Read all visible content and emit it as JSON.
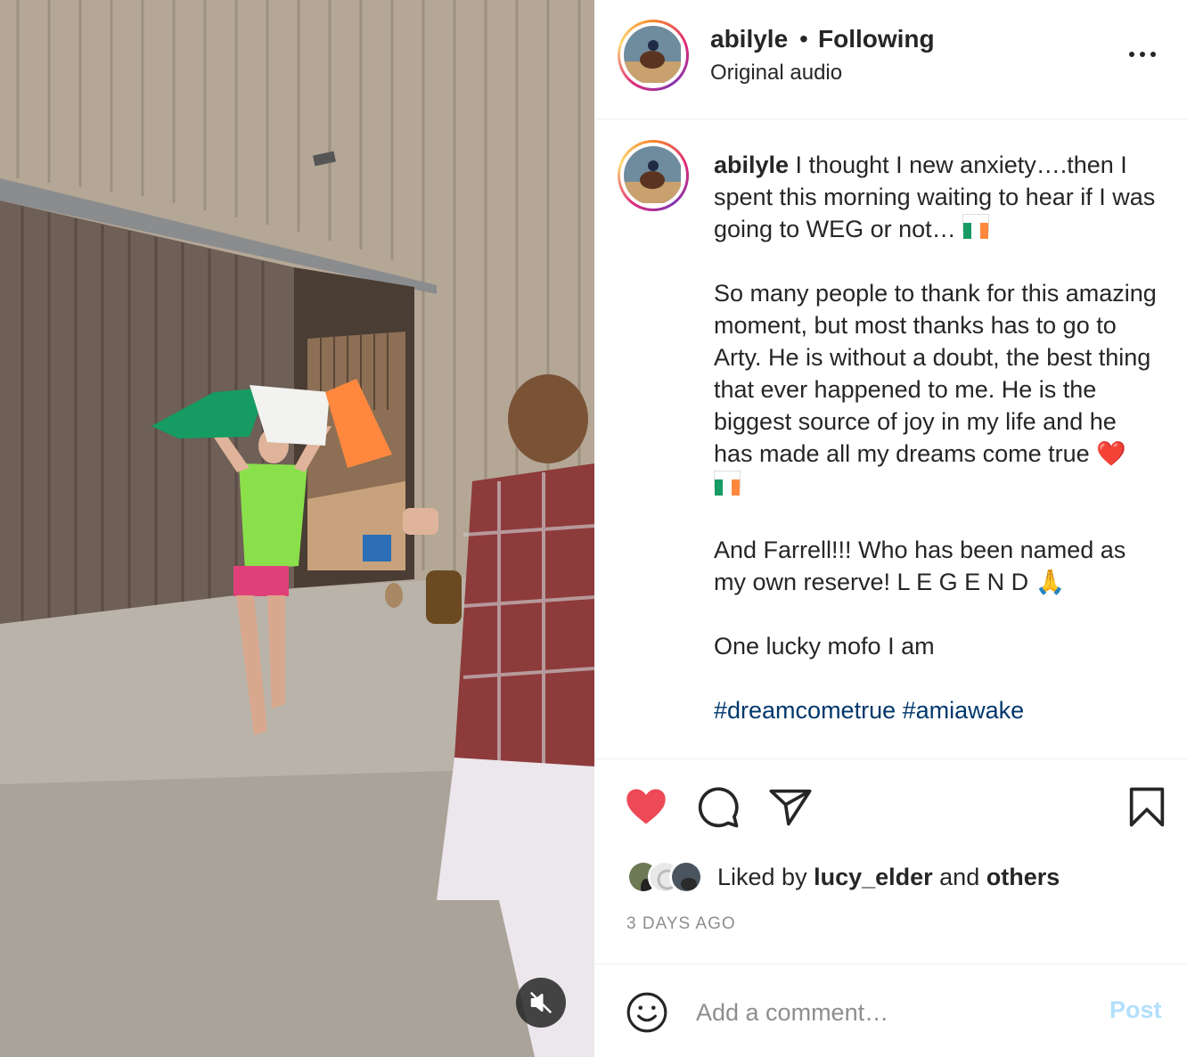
{
  "post": {
    "username": "abilyle",
    "separator": "•",
    "follow_status": "Following",
    "audio": "Original audio"
  },
  "caption": {
    "username": "abilyle",
    "line1": " I thought I new anxiety….then I spent this morning waiting to hear if I was going to WEG or not… ",
    "para2": "So many people to thank for this amazing moment, but most thanks has to go to Arty. He is without a doubt, the best thing that ever happened to me. He is the biggest source of joy in my life and he has made all my dreams come true ",
    "heart_emoji": "❤️",
    "para3": "And Farrell!!! Who has been named as my own reserve! L E G E N D ",
    "pray_emoji": "🙏",
    "para4": "One lucky mofo I am",
    "hashtags": [
      "#dreamcometrue",
      "#amiawake"
    ]
  },
  "actions": {
    "liked": true,
    "like_color": "#ed4956"
  },
  "likes": {
    "prefix": "Liked by ",
    "user": "lucy_elder",
    "middle": " and ",
    "others": "others"
  },
  "timestamp": "3 DAYS AGO",
  "comment": {
    "placeholder": "Add a comment…",
    "post_label": "Post"
  },
  "icons": {
    "more": "more-horizontal-icon",
    "like": "heart-filled-icon",
    "comment": "comment-bubble-icon",
    "share": "paper-plane-icon",
    "save": "bookmark-icon",
    "emoji": "smiley-icon",
    "mute": "speaker-muted-icon"
  },
  "colors": {
    "flag_green": "#169b62",
    "flag_white": "#ffffff",
    "flag_orange": "#ff883e",
    "hashtag": "#00376b",
    "post_disabled": "#b2dffc"
  }
}
